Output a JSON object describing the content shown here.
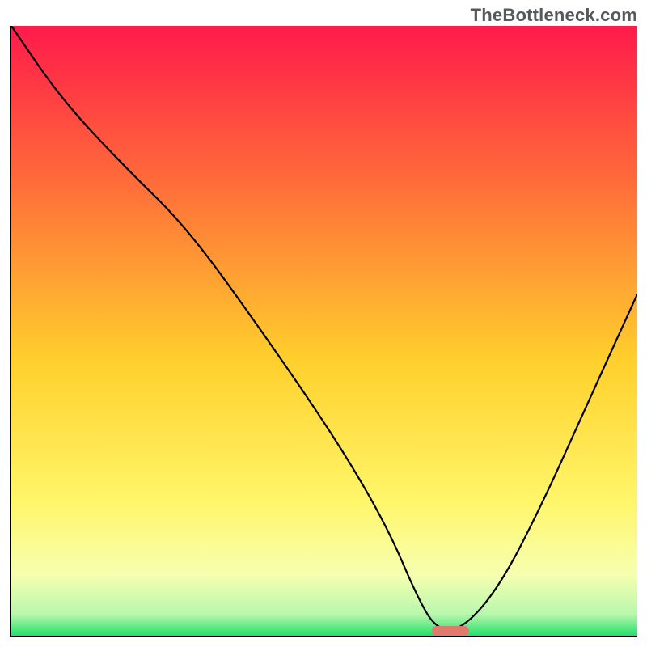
{
  "watermark": "TheBottleneck.com",
  "chart_data": {
    "type": "line",
    "title": "",
    "xlabel": "",
    "ylabel": "",
    "xlim": [
      0,
      100
    ],
    "ylim": [
      0,
      100
    ],
    "gradient_stops": [
      {
        "offset": 0,
        "color": "#ff1a4b"
      },
      {
        "offset": 0.25,
        "color": "#ff6a3a"
      },
      {
        "offset": 0.55,
        "color": "#ffd02c"
      },
      {
        "offset": 0.78,
        "color": "#fff66a"
      },
      {
        "offset": 0.9,
        "color": "#f6ffb0"
      },
      {
        "offset": 0.965,
        "color": "#b8f7ad"
      },
      {
        "offset": 1.0,
        "color": "#23e069"
      }
    ],
    "series": [
      {
        "name": "bottleneck-curve",
        "x": [
          0,
          8,
          18,
          28,
          40,
          52,
          60,
          65,
          68,
          72,
          78,
          85,
          92,
          100
        ],
        "y": [
          100,
          88,
          77,
          67,
          50,
          32,
          18,
          6,
          1,
          1,
          8,
          22,
          38,
          56
        ]
      }
    ],
    "marker": {
      "x_start": 67,
      "x_end": 73,
      "y": 0.5,
      "color": "#e07a6e"
    }
  }
}
